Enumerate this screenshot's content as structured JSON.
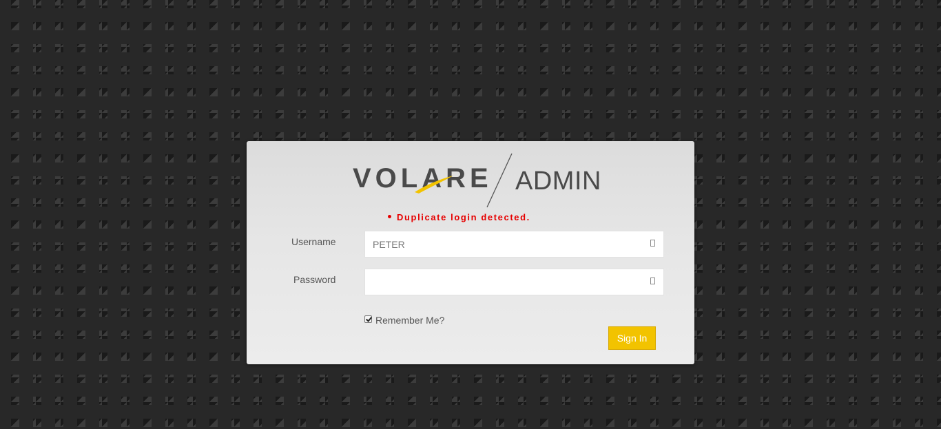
{
  "logo": {
    "brand": "VOLARE",
    "section": "ADMIN",
    "accent_color": "#f2c300"
  },
  "errors": [
    "Duplicate login detected."
  ],
  "form": {
    "username_label": "Username",
    "username_value": "PETER",
    "password_label": "Password",
    "password_value": "",
    "field_icon": "lock-icon",
    "remember_label": "Remember Me?",
    "remember_checked": true,
    "signin_label": "Sign In"
  },
  "colors": {
    "error": "#e60000",
    "button": "#f2c300",
    "background": "#262626"
  }
}
